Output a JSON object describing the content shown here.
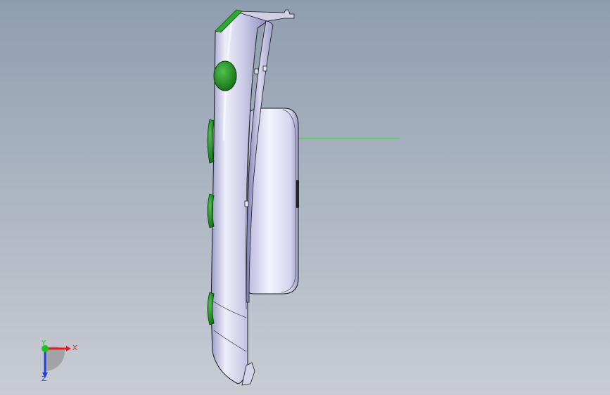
{
  "viewport": {
    "background_top": "#8f9db1",
    "background_bottom": "#c9cdd3"
  },
  "triad": {
    "x_label": "X",
    "y_label": "Y",
    "z_label": "Z",
    "x_color": "#e02020",
    "y_color": "#20c020",
    "z_color": "#2040e0"
  },
  "model": {
    "body_color": "#dcdcf0",
    "accent_color": "#2a9a2a",
    "edge_color": "#202020"
  }
}
